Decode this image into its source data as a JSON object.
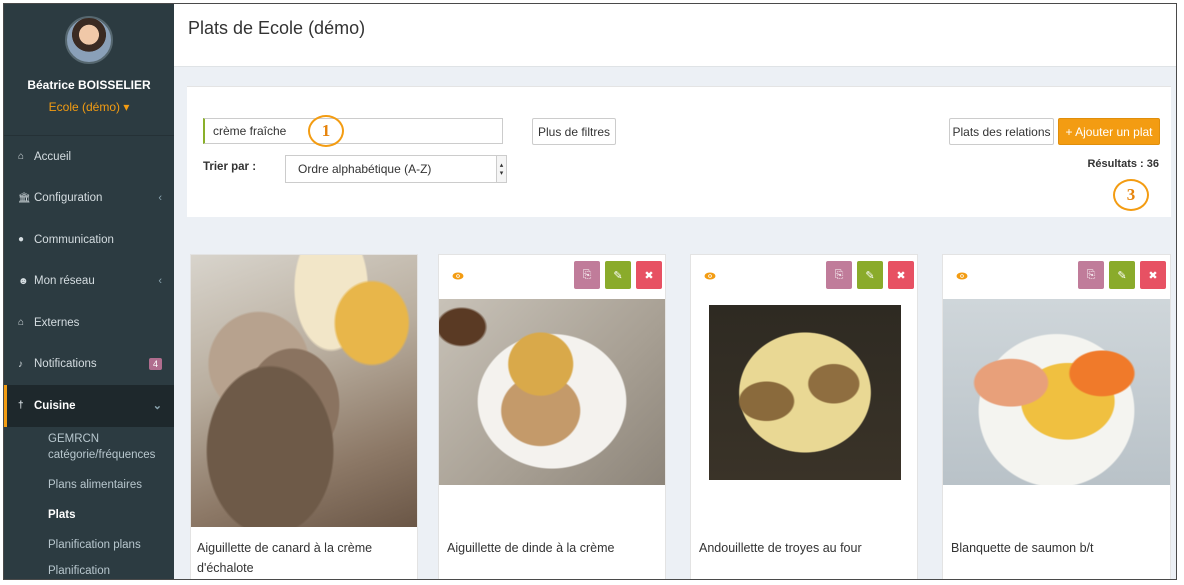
{
  "sidebar": {
    "user_name": "Béatrice BOISSELIER",
    "school": "Ecole (démo) ▾",
    "items": [
      {
        "label": "Accueil",
        "icon": "home-icon"
      },
      {
        "label": "Configuration",
        "icon": "bank-icon"
      },
      {
        "label": "Communication",
        "icon": "comments-icon"
      },
      {
        "label": "Mon réseau",
        "icon": "users-icon"
      },
      {
        "label": "Externes",
        "icon": "home-icon"
      },
      {
        "label": "Notifications",
        "icon": "bell-icon",
        "badge": "4"
      },
      {
        "label": "Cuisine",
        "icon": "cutlery-icon"
      }
    ],
    "sub_items": [
      "GEMRCN catégorie/fréquences",
      "Plans alimentaires",
      "Plats",
      "Planification plans",
      "Planification"
    ]
  },
  "header": {
    "title": "Plats de Ecole (démo)"
  },
  "filters": {
    "search_value": "crème fraîche",
    "more_filters_label": "Plus de filtres",
    "sort_label": "Trier par :",
    "sort_value": "Ordre alphabétique (A-Z)",
    "relations_label": "Plats des relations",
    "add_label": "+ Ajouter un plat",
    "results_label": "Résultats : 36"
  },
  "annotations": {
    "one": "1",
    "three": "3"
  },
  "cards": [
    {
      "title": "Aiguillette de canard à la crème d'échalote"
    },
    {
      "title": "Aiguillette de dinde à la crème"
    },
    {
      "title": "Andouillette de troyes au four"
    },
    {
      "title": "Blanquette de saumon b/t"
    }
  ],
  "colors": {
    "accent": "#f39c12",
    "sidebar": "#2c3b41",
    "copy": "#c07c9a",
    "edit": "#8aab2b",
    "delete": "#e75163"
  }
}
